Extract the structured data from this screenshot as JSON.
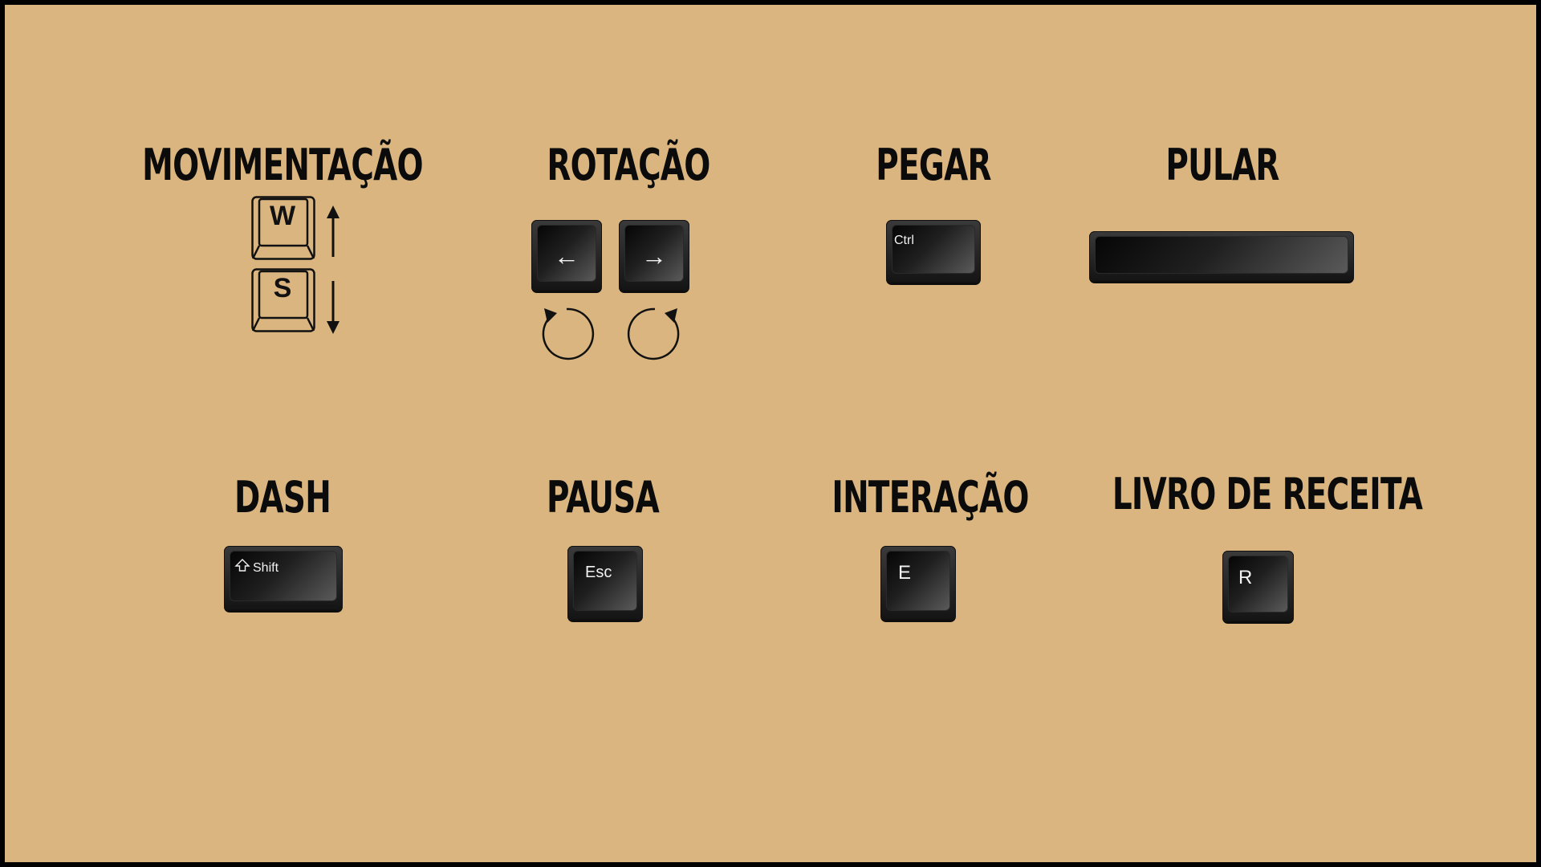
{
  "sections": {
    "movimentacao": {
      "title": "MOVIMENTAÇÃO",
      "keys": [
        "W",
        "S"
      ],
      "icons": [
        "arrow-up-icon",
        "arrow-down-icon"
      ]
    },
    "rotacao": {
      "title": "ROTAÇÃO",
      "keys": [
        "←",
        "→"
      ],
      "icons": [
        "rotate-left-icon",
        "rotate-right-icon"
      ]
    },
    "pegar": {
      "title": "PEGAR",
      "key": "Ctrl"
    },
    "pular": {
      "title": "PULAR",
      "key": ""
    },
    "dash": {
      "title": "DASH",
      "key": "Shift",
      "icon": "shift-arrow-icon"
    },
    "pausa": {
      "title": "PAUSA",
      "key": "Esc"
    },
    "interacao": {
      "title": "INTERAÇÃO",
      "key": "E"
    },
    "livro": {
      "title": "LIVRO DE RECEITA",
      "key": "R"
    }
  },
  "colors": {
    "background": "#dab57f",
    "frame": "#000000",
    "key": "#1a1a1a",
    "key_label": "#f2f2f2",
    "title": "#0b0b0b"
  }
}
